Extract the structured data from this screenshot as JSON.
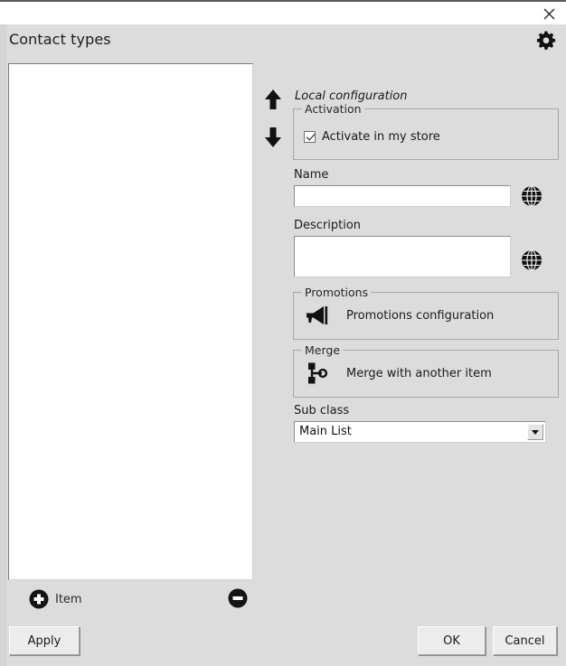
{
  "window": {
    "close_label": "✕"
  },
  "header": {
    "title": "Contact types",
    "settings_icon": "gear-icon"
  },
  "list_panel": {
    "items": [],
    "add_label": "Item",
    "add_icon": "plus-circle-icon",
    "remove_icon": "minus-circle-icon"
  },
  "right_panel": {
    "move_up_icon": "arrow-up-icon",
    "move_down_icon": "arrow-down-icon",
    "local_configuration_label": "Local configuration",
    "activation": {
      "group_title": "Activation",
      "checkbox_label": "Activate in my store",
      "checked": true
    },
    "name": {
      "label": "Name",
      "value": "",
      "placeholder": "",
      "translate_icon": "globe-icon"
    },
    "description": {
      "label": "Description",
      "value": "",
      "placeholder": "",
      "translate_icon": "globe-icon"
    },
    "promotions": {
      "group_title": "Promotions",
      "action_label": "Promotions configuration",
      "icon": "megaphone-icon"
    },
    "merge": {
      "group_title": "Merge",
      "action_label": "Merge with another item",
      "icon": "merge-branch-icon"
    },
    "sub_class": {
      "label": "Sub class",
      "selected": "Main List",
      "options": [
        "Main List"
      ],
      "arrow_icon": "chevron-down-icon"
    }
  },
  "footer": {
    "apply_label": "Apply",
    "ok_label": "OK",
    "cancel_label": "Cancel"
  },
  "colors": {
    "dialog_background": "#dcdcdc",
    "titlebar_background": "#ffffff",
    "field_background": "#ffffff",
    "border": "#a8a8a8",
    "text": "#1a1a1a"
  }
}
